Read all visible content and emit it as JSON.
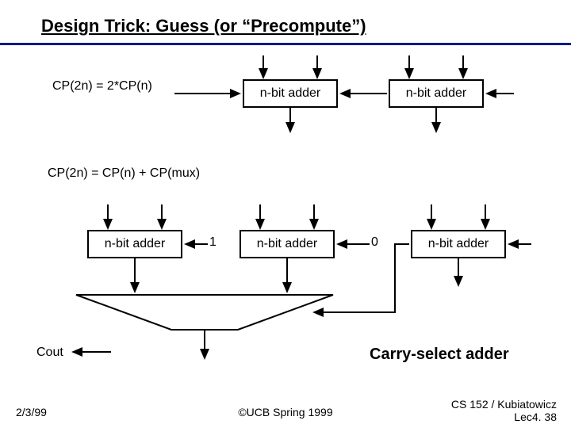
{
  "title": "Design Trick: Guess (or “Precompute”)",
  "eq1": "CP(2n) = 2*CP(n)",
  "eq2": "CP(2n) = CP(n) + CP(mux)",
  "block": {
    "adder": "n-bit adder"
  },
  "carry": {
    "one": "1",
    "zero": "0"
  },
  "labels": {
    "cout": "Cout",
    "caption": "Carry-select adder"
  },
  "footer": {
    "left": "2/3/99",
    "center": "©UCB Spring 1999",
    "right_line1": "CS 152 / Kubiatowicz",
    "right_line2": "Lec4. 38"
  }
}
